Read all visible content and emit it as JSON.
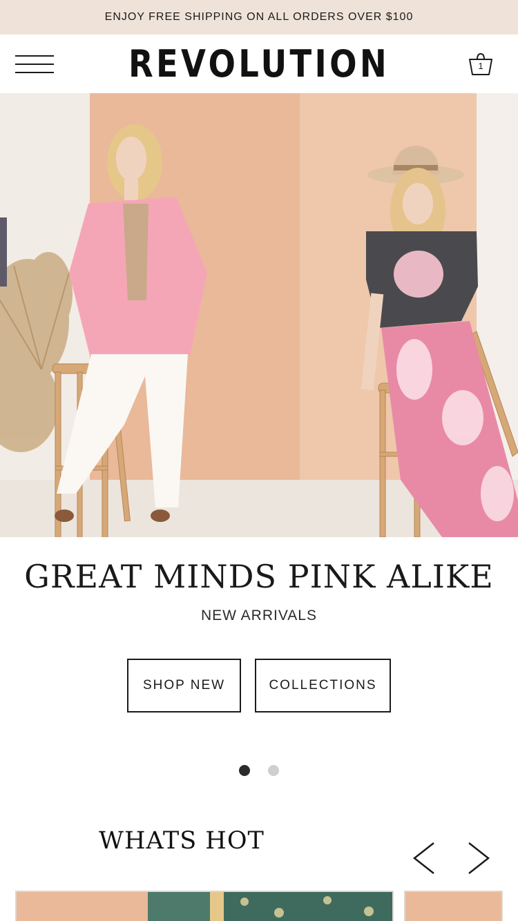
{
  "promo": {
    "text": "ENJOY FREE SHIPPING ON ALL ORDERS OVER $100"
  },
  "header": {
    "logo": "REVOLUTION",
    "menu_icon": "hamburger-menu-icon",
    "cart_icon": "shopping-basket-icon",
    "cart_count": "1"
  },
  "hero": {
    "image": "two models posing on wooden stools against a peach backdrop",
    "title": "GREAT MINDS PINK ALIKE",
    "subtitle": "NEW ARRIVALS",
    "buttons": [
      {
        "label": "SHOP NEW"
      },
      {
        "label": "COLLECTIONS"
      }
    ],
    "slides": {
      "active": 1,
      "total": 2
    }
  },
  "whats_hot": {
    "title": "WHATS HOT",
    "prev_icon": "chevron-left-icon",
    "next_icon": "chevron-right-icon"
  },
  "colors": {
    "promo_bg": "#efe3d9",
    "text": "#1a1a1a",
    "dot_active": "#2b2b2b",
    "dot_inactive": "#cfcfcf"
  }
}
